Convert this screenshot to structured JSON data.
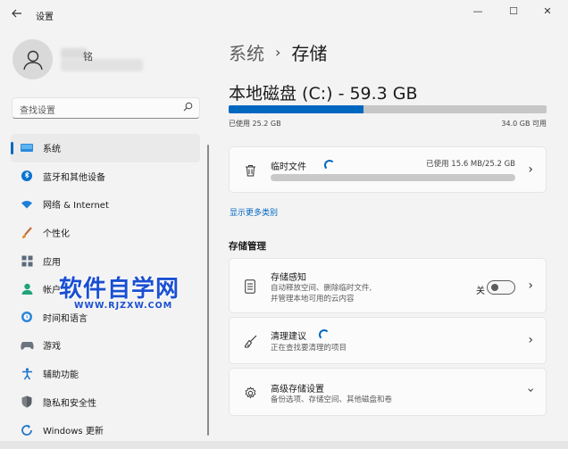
{
  "app": {
    "title": "设置"
  },
  "window": {
    "minimize": "—",
    "maximize": "☐",
    "close": "✕"
  },
  "user": {
    "name": "铭"
  },
  "search": {
    "placeholder": "查找设置"
  },
  "nav": {
    "items": [
      {
        "label": "系统",
        "icon": "monitor-icon",
        "active": true
      },
      {
        "label": "蓝牙和其他设备",
        "icon": "bluetooth-icon"
      },
      {
        "label": "网络 & Internet",
        "icon": "wifi-icon"
      },
      {
        "label": "个性化",
        "icon": "brush-icon"
      },
      {
        "label": "应用",
        "icon": "apps-icon"
      },
      {
        "label": "帐户",
        "icon": "person-icon"
      },
      {
        "label": "时间和语言",
        "icon": "globe-clock-icon"
      },
      {
        "label": "游戏",
        "icon": "gamepad-icon"
      },
      {
        "label": "辅助功能",
        "icon": "accessibility-icon"
      },
      {
        "label": "隐私和安全性",
        "icon": "shield-icon"
      },
      {
        "label": "Windows 更新",
        "icon": "update-icon"
      }
    ]
  },
  "breadcrumb": {
    "parent": "系统",
    "separator": "›",
    "current": "存储"
  },
  "disk": {
    "title": "本地磁盘 (C:) - 59.3 GB",
    "used_label": "已使用 25.2 GB",
    "available_label": "34.0 GB 可用",
    "used_fraction": 0.425,
    "fill_color": "#0067c0"
  },
  "temp_files": {
    "title": "临时文件",
    "used": "已使用 15.6 MB/25.2 GB"
  },
  "show_more": "显示更多类别",
  "storage_management": {
    "heading": "存储管理",
    "storage_sense": {
      "title": "存储感知",
      "desc_line1": "自动释放空间、删除临时文件,",
      "desc_line2": "并管理本地可用的云内容",
      "toggle_label": "关",
      "toggle_on": false
    },
    "cleanup": {
      "title": "清理建议",
      "desc": "正在查找要清理的项目"
    },
    "advanced": {
      "title": "高级存储设置",
      "desc": "备份选项、存储空间、其他磁盘和卷"
    }
  },
  "watermark": {
    "main": "软件自学网",
    "sub": "WWW.RJZXW.COM"
  }
}
